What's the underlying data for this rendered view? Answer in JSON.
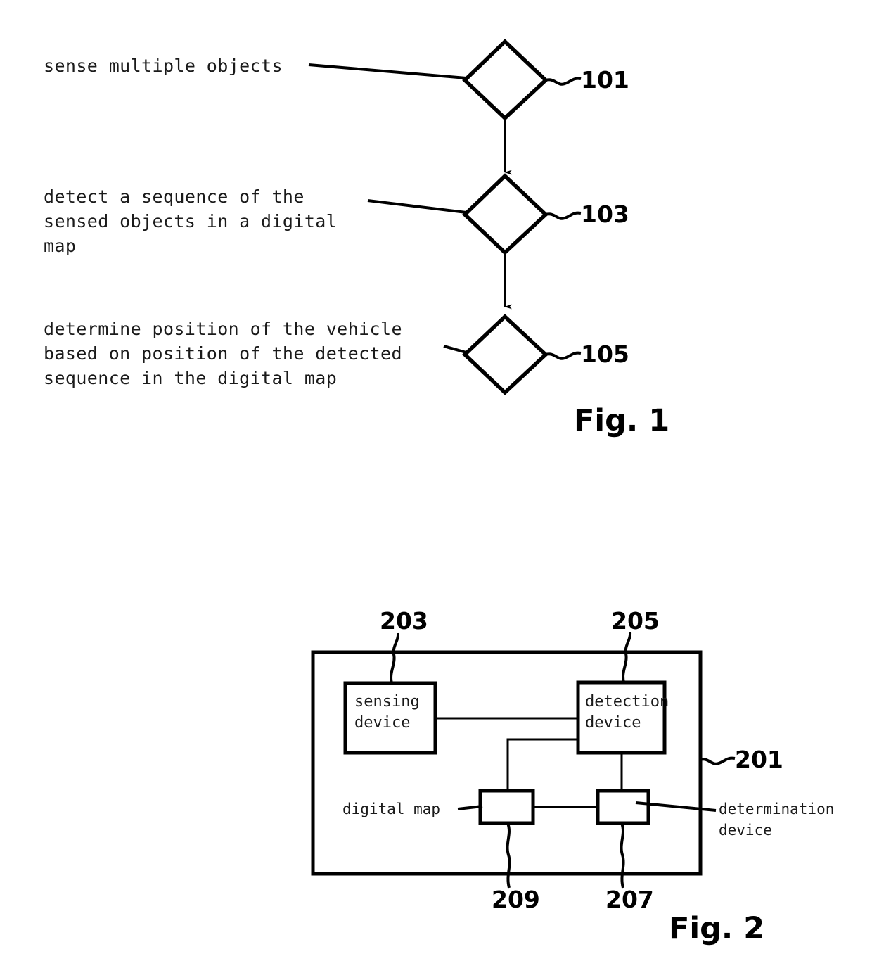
{
  "document": {
    "type": "patent-drawing-sheet",
    "background_color": "#ffffff",
    "ink_color": "#000000"
  },
  "figure1": {
    "caption": "Fig. 1",
    "steps": [
      {
        "ref": "101",
        "text_lines": [
          "sense multiple objects"
        ],
        "shape": "diamond"
      },
      {
        "ref": "103",
        "text_lines": [
          "detect a sequence of the",
          "sensed objects in a digital",
          "map"
        ],
        "shape": "diamond"
      },
      {
        "ref": "105",
        "text_lines": [
          "determine position of the vehicle",
          "based on position of the detected",
          "sequence in the digital map"
        ],
        "shape": "diamond"
      }
    ]
  },
  "figure2": {
    "caption": "Fig. 2",
    "enclosure_ref": "201",
    "blocks": [
      {
        "ref": "203",
        "label_lines": [
          "sensing",
          "device"
        ],
        "position": "top-left"
      },
      {
        "ref": "205",
        "label_lines": [
          "detection",
          "device"
        ],
        "position": "top-right"
      },
      {
        "ref": "209",
        "label_lines": [],
        "external_label": "digital map",
        "position": "bottom-left"
      },
      {
        "ref": "207",
        "label_lines": [],
        "external_label_lines": [
          "determination",
          "device"
        ],
        "position": "bottom-right"
      }
    ],
    "callouts": {
      "digital_map": "digital map",
      "determination_device_line1": "determination",
      "determination_device_line2": "device"
    }
  }
}
